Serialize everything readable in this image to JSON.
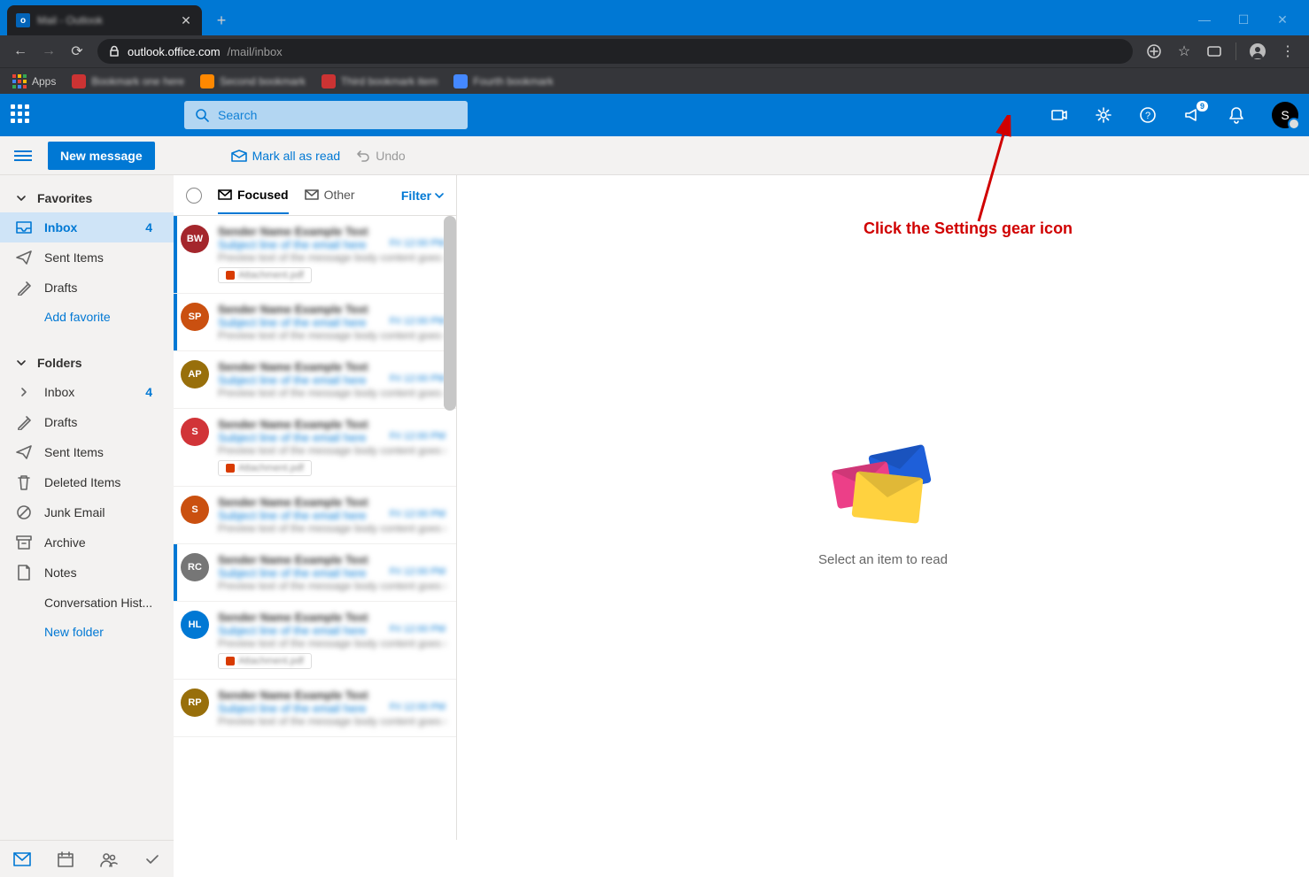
{
  "browser": {
    "tab_title": "Mail - Outlook",
    "url_host": "outlook.office.com",
    "url_path": "/mail/inbox",
    "apps_label": "Apps"
  },
  "header": {
    "search_placeholder": "Search",
    "notif_badge": "9",
    "avatar_initial": "S"
  },
  "toolbar": {
    "new_message": "New message",
    "mark_read": "Mark all as read",
    "undo": "Undo"
  },
  "sidebar": {
    "favorites_label": "Favorites",
    "folders_label": "Folders",
    "add_favorite": "Add favorite",
    "new_folder": "New folder",
    "favorites": [
      {
        "label": "Inbox",
        "count": "4",
        "active": true,
        "icon": "inbox"
      },
      {
        "label": "Sent Items",
        "icon": "send"
      },
      {
        "label": "Drafts",
        "icon": "draft"
      }
    ],
    "folders": [
      {
        "label": "Inbox",
        "count": "4",
        "icon": "chevron"
      },
      {
        "label": "Drafts",
        "icon": "draft"
      },
      {
        "label": "Sent Items",
        "icon": "send"
      },
      {
        "label": "Deleted Items",
        "icon": "trash"
      },
      {
        "label": "Junk Email",
        "icon": "block"
      },
      {
        "label": "Archive",
        "icon": "archive"
      },
      {
        "label": "Notes",
        "icon": "note"
      },
      {
        "label": "Conversation Hist...",
        "icon": "none"
      }
    ]
  },
  "list": {
    "focused": "Focused",
    "other": "Other",
    "filter": "Filter",
    "messages": [
      {
        "initials": "BW",
        "color": "#a4262c",
        "unread": true,
        "att": true
      },
      {
        "initials": "SP",
        "color": "#ca5010",
        "unread": true
      },
      {
        "initials": "AP",
        "color": "#986f0b"
      },
      {
        "initials": "S",
        "color": "#d13438",
        "att": true
      },
      {
        "initials": "S",
        "color": "#ca5010"
      },
      {
        "initials": "RC",
        "color": "#767676",
        "unread": true
      },
      {
        "initials": "HL",
        "color": "#0078d4",
        "att": true
      },
      {
        "initials": "RP",
        "color": "#986f0b"
      }
    ]
  },
  "reading": {
    "empty_text": "Select an item to read"
  },
  "annotation": {
    "text": "Click the Settings gear icon"
  }
}
